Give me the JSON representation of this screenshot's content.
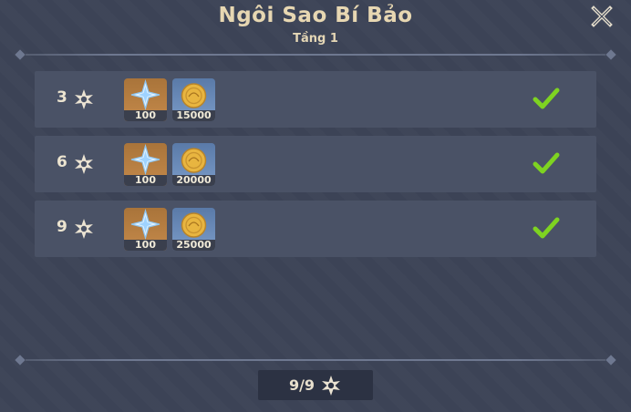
{
  "header": {
    "title": "Ngôi Sao Bí Bảo",
    "subtitle": "Tầng 1"
  },
  "rows": [
    {
      "stars": "3",
      "rewards": [
        {
          "icon": "primogem-icon",
          "qty": "100"
        },
        {
          "icon": "mora-coin-icon",
          "qty": "15000"
        }
      ],
      "claimed": true
    },
    {
      "stars": "6",
      "rewards": [
        {
          "icon": "primogem-icon",
          "qty": "100"
        },
        {
          "icon": "mora-coin-icon",
          "qty": "20000"
        }
      ],
      "claimed": true
    },
    {
      "stars": "9",
      "rewards": [
        {
          "icon": "primogem-icon",
          "qty": "100"
        },
        {
          "icon": "mora-coin-icon",
          "qty": "25000"
        }
      ],
      "claimed": true
    }
  ],
  "footer": {
    "progress": "9/9"
  },
  "colors": {
    "background": "#3c4356",
    "row": "#4a5266",
    "title": "#e7d7b2",
    "check": "#7ed321"
  }
}
